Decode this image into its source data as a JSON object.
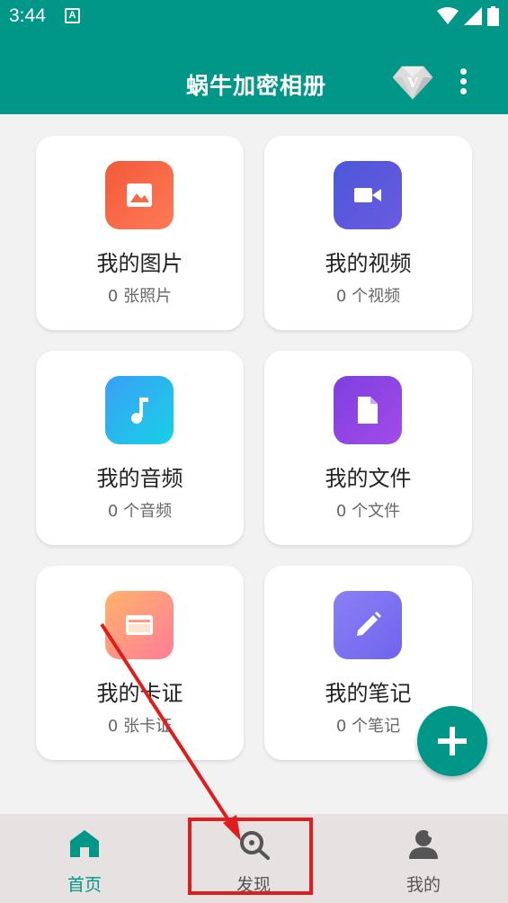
{
  "status_bar": {
    "time": "3:44",
    "notification_badge": "A",
    "icons": [
      "wifi-icon",
      "signal-icon",
      "battery-icon"
    ]
  },
  "app_bar": {
    "title": "蜗牛加密相册",
    "vip_badge": "V",
    "menu_icon": "more-vert-icon"
  },
  "categories": [
    {
      "title": "我的图片",
      "subtitle": "0 张照片",
      "icon": "image-icon",
      "gradient": [
        "#f25a3a",
        "#ff7a55"
      ]
    },
    {
      "title": "我的视频",
      "subtitle": "0 个视频",
      "icon": "video-icon",
      "gradient": [
        "#4d57d9",
        "#6a5ae0"
      ]
    },
    {
      "title": "我的音频",
      "subtitle": "0 个音频",
      "icon": "music-note-icon",
      "gradient": [
        "#3aa0f5",
        "#18d0e6"
      ]
    },
    {
      "title": "我的文件",
      "subtitle": "0 个文件",
      "icon": "file-icon",
      "gradient": [
        "#7e3fe0",
        "#a24be8"
      ]
    },
    {
      "title": "我的卡证",
      "subtitle": "0 张卡证",
      "icon": "card-icon",
      "gradient": [
        "#ffb36a",
        "#ff7d98"
      ]
    },
    {
      "title": "我的笔记",
      "subtitle": "0 个笔记",
      "icon": "pencil-icon",
      "gradient": [
        "#8b80f5",
        "#6f64ec"
      ]
    }
  ],
  "fab": {
    "icon": "plus-icon"
  },
  "bottom_nav": [
    {
      "label": "首页",
      "icon": "home-icon",
      "active": true
    },
    {
      "label": "发现",
      "icon": "search-icon",
      "active": false
    },
    {
      "label": "我的",
      "icon": "person-icon",
      "active": false
    }
  ],
  "colors": {
    "primary": "#009688",
    "background": "#f2f2f2",
    "bottom_nav_bg": "#e6e2e1",
    "annotation_red": "#e01d1d"
  }
}
